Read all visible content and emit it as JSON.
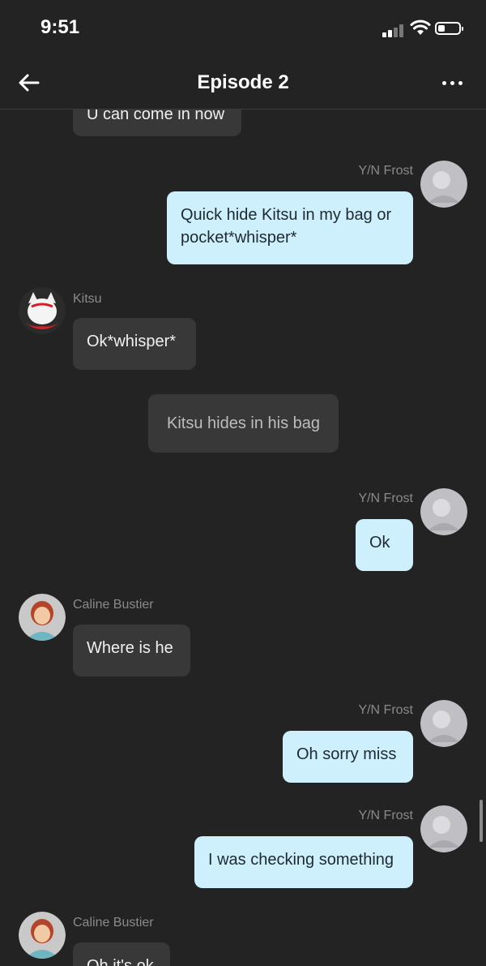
{
  "status": {
    "time": "9:51"
  },
  "header": {
    "title": "Episode 2"
  },
  "messages": [
    {
      "kind": "other",
      "text": "U can come in now"
    },
    {
      "kind": "me",
      "name": "Y/N Frost",
      "text": "Quick hide Kitsu in my bag or pocket*whisper*"
    },
    {
      "kind": "other",
      "name": "Kitsu",
      "text": "Ok*whisper*"
    },
    {
      "kind": "narration",
      "text": "Kitsu hides in his bag"
    },
    {
      "kind": "me",
      "name": "Y/N Frost",
      "text": "Ok"
    },
    {
      "kind": "other",
      "name": "Caline Bustier",
      "text": "Where is he"
    },
    {
      "kind": "me",
      "name": "Y/N Frost",
      "text": "Oh sorry miss"
    },
    {
      "kind": "me",
      "name": "Y/N Frost",
      "text": "I was checking something"
    },
    {
      "kind": "other",
      "name": "Caline Bustier",
      "text": "Oh it's ok"
    }
  ],
  "colors": {
    "background": "#232323",
    "my_bubble": "#cdf0fc",
    "other_bubble": "#383838"
  }
}
